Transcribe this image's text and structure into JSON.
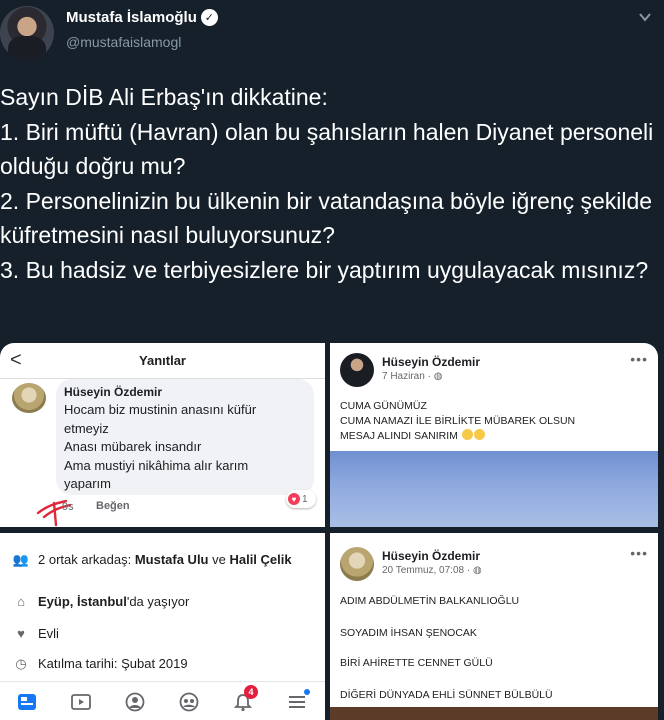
{
  "tweet": {
    "display_name": "Mustafa İslamoğlu",
    "verified_glyph": "✓",
    "handle": "@mustafaislamogl",
    "text": "Sayın DİB Ali Erbaş'ın dikkatine:\n1. Biri müftü (Havran) olan bu şahısların halen Diyanet personeli olduğu doğru mu?\n2. Personelinizin bu ülkenin bir vatandaşına böyle iğrenç şekilde küfretmesini nasıl buluyorsunuz?\n3. Bu hadsiz ve terbiyesizlere bir yaptırım uygulayacak mısınız?"
  },
  "panel_replies": {
    "back_glyph": "<",
    "title": "Yanıtlar",
    "comment_author": "Hüseyin Özdemir",
    "comment_text": "Hocam biz mustinin anasını küfür\netmeyiz\nAnası mübarek insandır\nAma mustiyi nikâhima alır karım\nyaparım",
    "time": "9s",
    "like_label": "Beğen",
    "reaction_count": "1"
  },
  "panel_post1": {
    "author": "Hüseyin Özdemir",
    "date": "7 Haziran · ",
    "more": "•••",
    "text": "CUMA GÜNÜMÜZ\nCUMA NAMAZI İLE BİRLİKTE MÜBAREK OLSUN\nMESAJ ALINDI SANIRIM "
  },
  "panel_profile": {
    "mutual_prefix": "2 ortak arkadaş: ",
    "mutual_name1": "Mustafa Ulu",
    "mutual_and": " ve ",
    "mutual_name2": "Halil Çelik",
    "location_bold": "Eyüp, İstanbul",
    "location_suffix": "'da yaşıyor",
    "relationship": "Evli",
    "joined": "Katılma tarihi: Şubat 2019",
    "notification_count": "4"
  },
  "panel_post2": {
    "author": "Hüseyin Özdemir",
    "date": "20 Temmuz, 07:08 · ",
    "more": "•••",
    "lines": [
      "ADIM ABDÜLMETİN BALKANLIOĞLU",
      "SOYADIM İHSAN ŞENOCAK",
      "BİRİ AHİRETTE CENNET GÜLÜ",
      "DİĞERİ DÜNYADA  EHLİ SÜNNET BÜLBÜLÜ"
    ]
  },
  "colors": {
    "background": "#15202b",
    "text_primary": "#ffffff",
    "text_secondary": "#8899a6",
    "facebook_blue": "#1877f2",
    "notification_red": "#e41e3f"
  },
  "icons": [
    "chevron-down-icon",
    "verified-badge-icon",
    "back-arrow-icon",
    "globe-icon",
    "friends-icon",
    "home-icon",
    "heart-icon",
    "clock-icon",
    "news-feed-icon",
    "video-icon",
    "profile-icon",
    "groups-icon",
    "bell-icon",
    "menu-icon"
  ]
}
